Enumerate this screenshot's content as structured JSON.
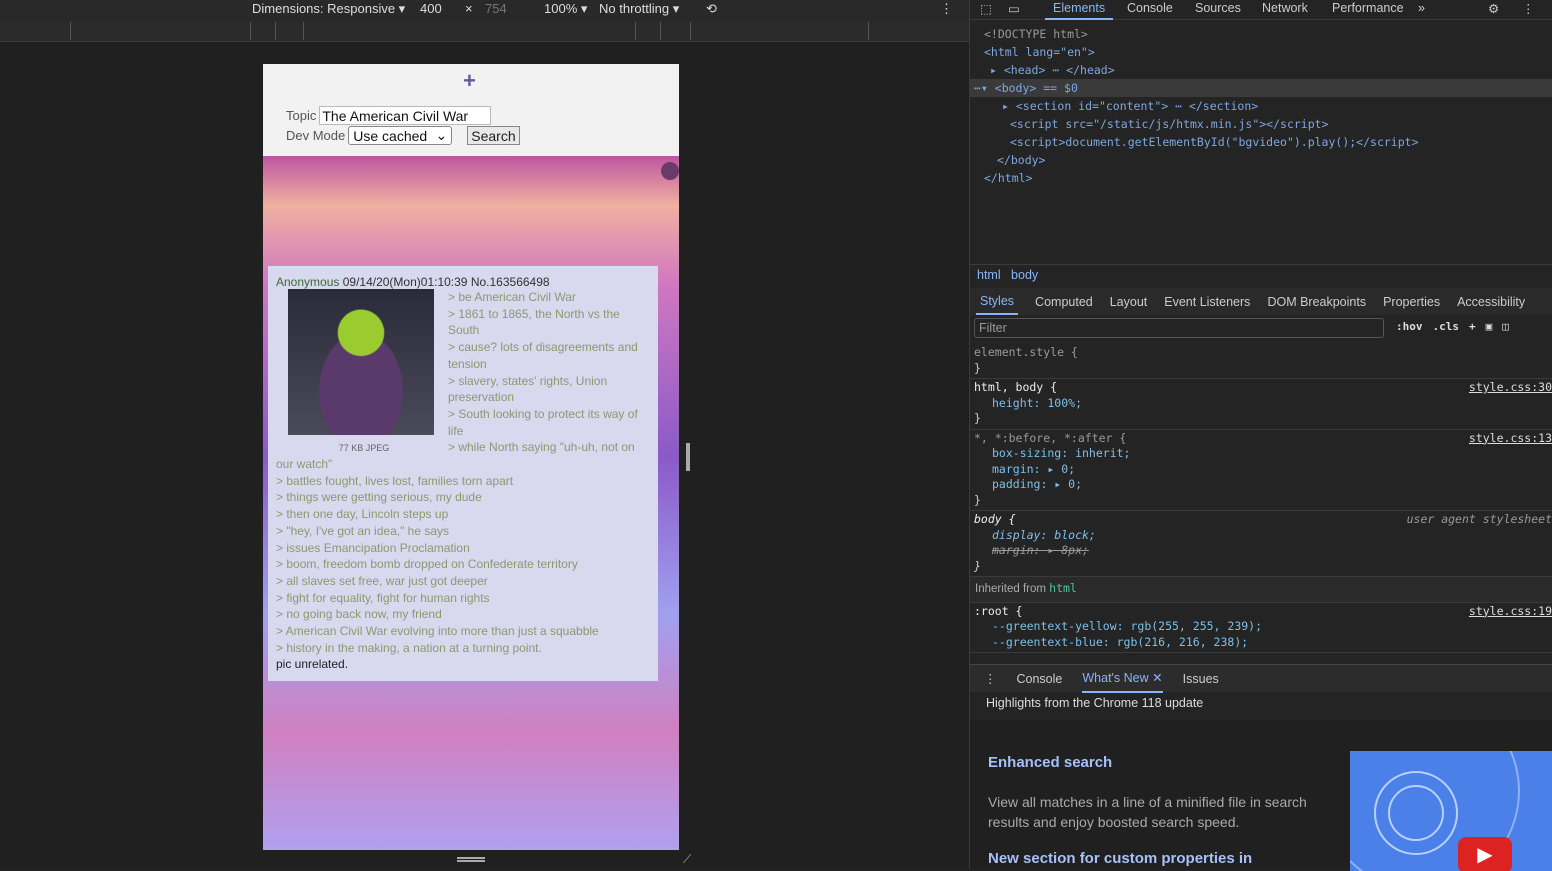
{
  "device_toolbar": {
    "dimensions": "Dimensions: Responsive ▾",
    "width": "400",
    "times": "×",
    "height": "754",
    "zoom": "100% ▾",
    "throttling": "No throttling ▾"
  },
  "app": {
    "plus": "+",
    "topic_label": "Topic",
    "topic_value": "The American Civil War",
    "devmode_label": "Dev Mode",
    "devmode_value": "Use cached",
    "search_label": "Search"
  },
  "post": {
    "name": "Anonymous",
    "datetime": "09/14/20(Mon)01:10:39",
    "number": "No.163566498",
    "file_info": "77 KB JPEG",
    "side_lines": [
      "> be American Civil War",
      "> 1861 to 1865, the North vs the South",
      "> cause? lots of disagreements and tension",
      "> slavery, states' rights, Union preservation",
      "> South looking to protect its way of life",
      "> while North saying \"uh-uh, not on our watch\""
    ],
    "lines": [
      "> battles fought, lives lost, families torn apart",
      "> things were getting serious, my dude",
      "> then one day, Lincoln steps up",
      "> \"hey, I've got an idea,\" he says",
      "> issues Emancipation Proclamation",
      "> boom, freedom bomb dropped on Confederate territory",
      "> all slaves set free, war just got deeper",
      "> fight for equality, fight for human rights",
      "> no going back now, my friend",
      "> American Civil War evolving into more than just a squabble",
      "> history in the making, a nation at a turning point."
    ],
    "footer": "pic unrelated."
  },
  "devtools": {
    "tabs": [
      "Elements",
      "Console",
      "Sources",
      "Network",
      "Performance",
      "»"
    ],
    "dom": {
      "doctype": "<!DOCTYPE html>",
      "html_open": "<html lang=\"en\">",
      "head": "<head> ⋯ </head>",
      "body": "<body> == $0",
      "section": "<section id=\"content\"> ⋯ </section>",
      "script1": "<script src=\"/static/js/htmx.min.js\"></script>",
      "script2": "<script>document.getElementById(\"bgvideo\").play();</script>",
      "body_close": "</body>",
      "html_close": "</html>"
    },
    "breadcrumbs": [
      "html",
      "body"
    ],
    "style_tabs": [
      "Styles",
      "Computed",
      "Layout",
      "Event Listeners",
      "DOM Breakpoints",
      "Properties",
      "Accessibility"
    ],
    "filter_placeholder": "Filter",
    "hov": ":hov",
    "cls": ".cls",
    "rules": {
      "r1_sel": "element.style {",
      "close": "}",
      "r2_sel": "html, body {",
      "r2_src": "style.css:30",
      "r2_p1": "height: 100%;",
      "r3_sel": "*, *:before, *:after {",
      "r3_src": "style.css:13",
      "r3_p1": "box-sizing: inherit;",
      "r3_p2": "margin: ▸ 0;",
      "r3_p3": "padding: ▸ 0;",
      "r4_sel": "body {",
      "r4_src": "user agent stylesheet",
      "r4_p1": "display: block;",
      "r4_p2": "margin: ▸ 8px;",
      "inherited": "Inherited from",
      "inherited_el": "html",
      "r5_sel": ":root {",
      "r5_src": "style.css:19",
      "r5_p1": "--greentext-yellow: rgb(255, 255, 239);",
      "r5_p2": "--greentext-blue: rgb(216, 216, 238);"
    },
    "drawer_tabs": [
      "Console",
      "What's New",
      "Issues"
    ],
    "highlights": "Highlights from the Chrome 118 update",
    "whatsnew": {
      "h1": "Enhanced search",
      "p1": "View all matches in a line of a minified file in search results and enjoy boosted search speed.",
      "h2": "New section for custom properties in"
    }
  }
}
